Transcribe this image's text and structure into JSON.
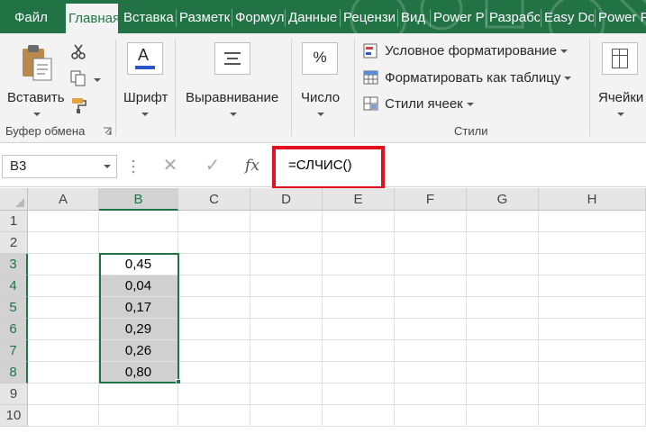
{
  "tabs": [
    "Файл",
    "Главная",
    "Вставка",
    "Разметк",
    "Формул",
    "Данные",
    "Рецензи",
    "Вид",
    "Power P",
    "Разрабс",
    "Easy Do",
    "Power P"
  ],
  "active_tab_index": 1,
  "ribbon": {
    "clipboard": {
      "paste_label": "Вставить",
      "group_label": "Буфер обмена"
    },
    "font": {
      "label": "Шрифт"
    },
    "alignment": {
      "label": "Выравнивание"
    },
    "number": {
      "label": "Число",
      "icon_glyph": "%"
    },
    "styles": {
      "conditional": "Условное форматирование",
      "format_table": "Форматировать как таблицу",
      "cell_styles": "Стили ячеек",
      "group_label": "Стили"
    },
    "cells": {
      "label": "Ячейки"
    }
  },
  "formula_bar": {
    "name_box": "B3",
    "cancel_glyph": "✕",
    "enter_glyph": "✓",
    "fx_glyph": "fx",
    "formula": "=СЛЧИС()",
    "highlight_color": "#e2101e"
  },
  "grid": {
    "columns": [
      "A",
      "B",
      "C",
      "D",
      "E",
      "F",
      "G",
      "H"
    ],
    "rows": [
      "1",
      "2",
      "3",
      "4",
      "5",
      "6",
      "7",
      "8",
      "9",
      "10"
    ],
    "selected_column": "B",
    "selected_rows": [
      "3",
      "4",
      "5",
      "6",
      "7",
      "8"
    ],
    "active_cell": "B3",
    "values_column_b": [
      {
        "row": "3",
        "value": "0,45"
      },
      {
        "row": "4",
        "value": "0,04"
      },
      {
        "row": "5",
        "value": "0,17"
      },
      {
        "row": "6",
        "value": "0,29"
      },
      {
        "row": "7",
        "value": "0,26"
      },
      {
        "row": "8",
        "value": "0,80"
      }
    ]
  },
  "colors": {
    "accent": "#217346",
    "selection_fill": "#d0d0d0"
  }
}
